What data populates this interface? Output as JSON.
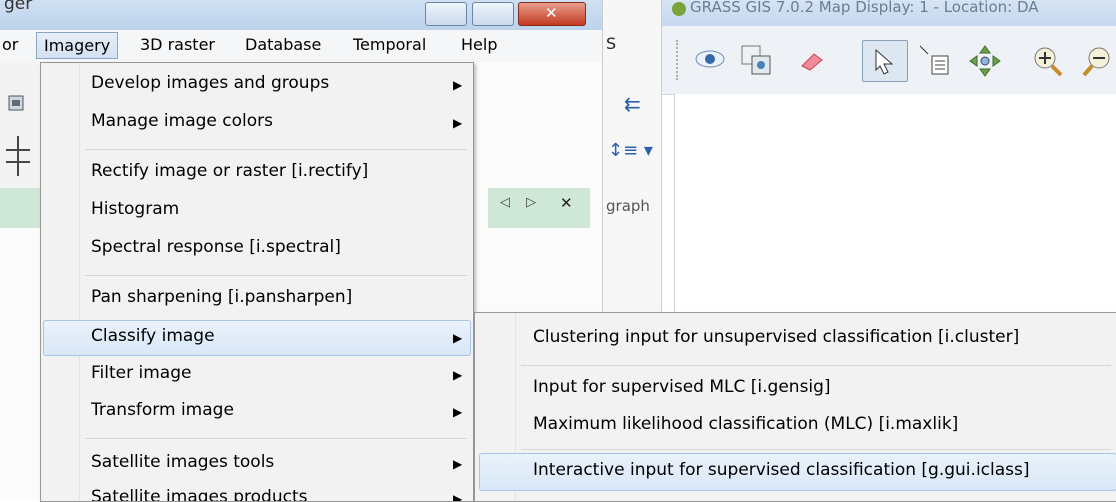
{
  "manager": {
    "title_fragment": "ger",
    "close_glyph": "✕",
    "menubar": {
      "partial_left": "or",
      "items": [
        "Imagery",
        "3D raster",
        "Database",
        "Temporal",
        "Help"
      ]
    },
    "tab_arrows": "◁ ▷",
    "tab_close": "✕"
  },
  "middle_panel": {
    "s_fragment": "S",
    "graph_fragment": "graph"
  },
  "map_display": {
    "title": "GRASS GIS 7.0.2 Map Display: 1  - Location: DA",
    "tools": [
      "display-map-icon",
      "overlay-icon",
      "erase-icon",
      "pointer-icon",
      "query-icon",
      "pan-icon",
      "zoom-in-icon",
      "zoom-out-icon"
    ]
  },
  "imagery_menu": {
    "items": [
      {
        "label": "Develop images and groups",
        "submenu": true
      },
      {
        "label": "Manage image colors",
        "submenu": true
      },
      {
        "label": "Rectify image or raster  [i.rectify]",
        "submenu": false
      },
      {
        "label": "Histogram",
        "submenu": false
      },
      {
        "label": "Spectral response  [i.spectral]",
        "submenu": false
      },
      {
        "label": "Pan sharpening  [i.pansharpen]",
        "submenu": false
      },
      {
        "label": "Classify image",
        "submenu": true,
        "highlighted": true
      },
      {
        "label": "Filter image",
        "submenu": true
      },
      {
        "label": "Transform image",
        "submenu": true
      },
      {
        "label": "Satellite images tools",
        "submenu": true
      },
      {
        "label": "Satellite images products",
        "submenu": true
      }
    ]
  },
  "classify_submenu": {
    "items": [
      {
        "label": "Clustering input for unsupervised classification  [i.cluster]"
      },
      {
        "label": "Input for supervised MLC  [i.gensig]"
      },
      {
        "label": "Maximum likelihood classification (MLC)  [i.maxlik]"
      },
      {
        "label": "Interactive input for supervised classification  [g.gui.iclass]",
        "highlighted": true
      }
    ]
  },
  "colors": {
    "menu_highlight": "#d9e7f7",
    "tab_strip": "#cfe7d6",
    "close_button": "#c2391f"
  }
}
